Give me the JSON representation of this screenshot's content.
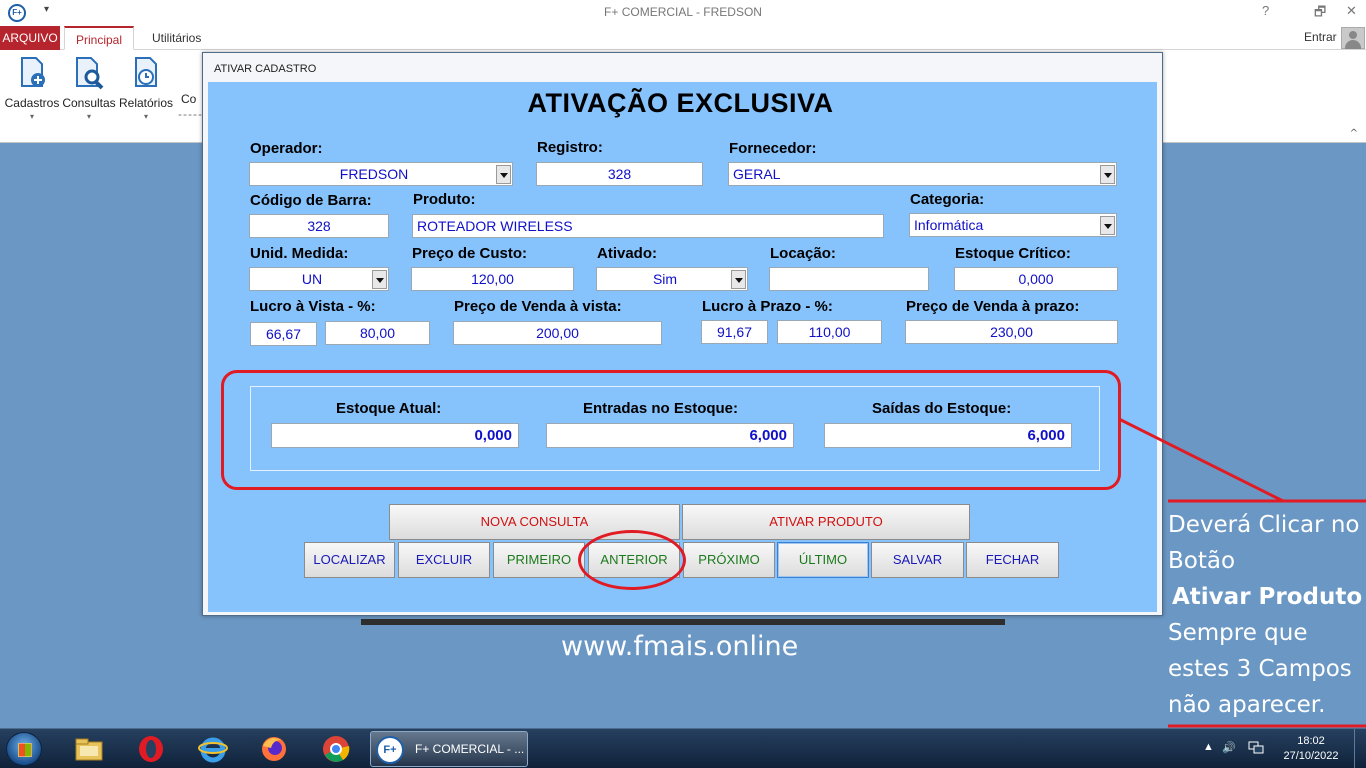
{
  "window": {
    "title": "F+ COMERCIAL - FREDSON",
    "icon_text": "F+",
    "help": "?",
    "restore": "🗗",
    "close": "✕"
  },
  "ribbon": {
    "tabs": [
      "ARQUIVO",
      "Principal",
      "Utilitários"
    ],
    "account": "Entrar",
    "buttons": [
      "Cadastros",
      "Consultas",
      "Relatórios",
      "Co"
    ],
    "dashes": "-----",
    "collapse": "^"
  },
  "dialog": {
    "title": "ATIVAR CADASTRO",
    "heading": "ATIVAÇÃO EXCLUSIVA",
    "labels": {
      "operador": "Operador:",
      "registro": "Registro:",
      "fornecedor": "Fornecedor:",
      "codigo_barra": "Código de Barra:",
      "produto": "Produto:",
      "categoria": "Categoria:",
      "unid_medida": "Unid. Medida:",
      "preco_custo": "Preço de Custo:",
      "ativado": "Ativado:",
      "locacao": "Locação:",
      "estoque_critico": "Estoque Crítico:",
      "lucro_vista": "Lucro à Vista - %:",
      "preco_venda_vista": "Preço de Venda à vista:",
      "lucro_prazo": "Lucro à Prazo - %:",
      "preco_venda_prazo": "Preço de Venda à prazo:",
      "estoque_atual": "Estoque Atual:",
      "entradas": "Entradas no Estoque:",
      "saidas": "Saídas do Estoque:"
    },
    "values": {
      "operador": "FREDSON",
      "registro": "328",
      "fornecedor": "GERAL",
      "codigo_barra": "328",
      "produto": "ROTEADOR WIRELESS",
      "categoria": "Informática",
      "unid_medida": "UN",
      "preco_custo": "120,00",
      "ativado": "Sim",
      "locacao": "",
      "estoque_critico": "0,000",
      "lucro_vista_pct": "66,67",
      "lucro_vista_val": "80,00",
      "preco_venda_vista": "200,00",
      "lucro_prazo_pct": "91,67",
      "lucro_prazo_val": "110,00",
      "preco_venda_prazo": "230,00",
      "estoque_atual": "0,000",
      "entradas": "6,000",
      "saidas": "6,000"
    },
    "buttons": {
      "nova_consulta": "NOVA CONSULTA",
      "ativar_produto": "ATIVAR PRODUTO",
      "localizar": "LOCALIZAR",
      "excluir": "EXCLUIR",
      "primeiro": "PRIMEIRO",
      "anterior": "ANTERIOR",
      "proximo": "PRÓXIMO",
      "ultimo": "ÚLTIMO",
      "salvar": "SALVAR",
      "fechar": "FECHAR"
    }
  },
  "overlay": {
    "website": "www.fmais.online",
    "note_lines": [
      "Deverá Clicar no",
      "Botão",
      "Ativar Produto",
      "Sempre que",
      "estes 3 Campos",
      "não aparecer."
    ]
  },
  "taskbar": {
    "task_label": "F+ COMERCIAL - ...",
    "task_icon_text": "F+",
    "tray_up": "▲",
    "tray_volume": "🔊",
    "time": "18:02",
    "date": "27/10/2022"
  },
  "colors": {
    "ribbon_accent": "#b6252d",
    "dialog_body": "#86c2fb",
    "field_text": "#1010c8",
    "annotation_red": "#e01b24",
    "desktop": "#6b97c4"
  }
}
